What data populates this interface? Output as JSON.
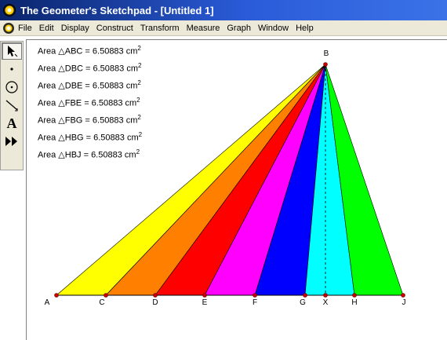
{
  "window": {
    "title": "The Geometer's Sketchpad - [Untitled 1]"
  },
  "menu": {
    "items": [
      "File",
      "Edit",
      "Display",
      "Construct",
      "Transform",
      "Measure",
      "Graph",
      "Window",
      "Help"
    ]
  },
  "toolbox": {
    "tools": [
      {
        "name": "selection-arrow-tool",
        "icon": "arrow-icon"
      },
      {
        "name": "point-tool",
        "icon": "point-icon"
      },
      {
        "name": "compass-tool",
        "icon": "circle-icon"
      },
      {
        "name": "straightedge-tool",
        "icon": "segment-icon"
      },
      {
        "name": "text-tool",
        "icon": "text-a-icon",
        "glyph": "A"
      },
      {
        "name": "custom-tool",
        "icon": "double-arrow-icon"
      }
    ]
  },
  "measurements": [
    {
      "label": "Area △ABC = 6.50883 cm",
      "sup": "2"
    },
    {
      "label": "Area △DBC = 6.50883 cm",
      "sup": "2"
    },
    {
      "label": "Area △DBE = 6.50883 cm",
      "sup": "2"
    },
    {
      "label": "Area △FBE = 6.50883 cm",
      "sup": "2"
    },
    {
      "label": "Area △FBG = 6.50883 cm",
      "sup": "2"
    },
    {
      "label": "Area △HBG = 6.50883 cm",
      "sup": "2"
    },
    {
      "label": "Area △HBJ = 6.50883 cm",
      "sup": "2"
    }
  ],
  "points": {
    "apex": "B",
    "base": [
      "A",
      "C",
      "D",
      "E",
      "F",
      "G",
      "X",
      "H",
      "J"
    ]
  },
  "triangles": [
    {
      "name": "ABC",
      "color": "#ffff00"
    },
    {
      "name": "DBC",
      "color": "#ff8000"
    },
    {
      "name": "DBE",
      "color": "#ff0000"
    },
    {
      "name": "FBE",
      "color": "#ff00ff"
    },
    {
      "name": "FBG",
      "color": "#0000ff"
    },
    {
      "name": "HBG",
      "color": "#00ffff"
    },
    {
      "name": "HBJ",
      "color": "#00ff00"
    }
  ],
  "colors": {
    "point": "#cc0000",
    "titlebar": "#0a246a"
  }
}
